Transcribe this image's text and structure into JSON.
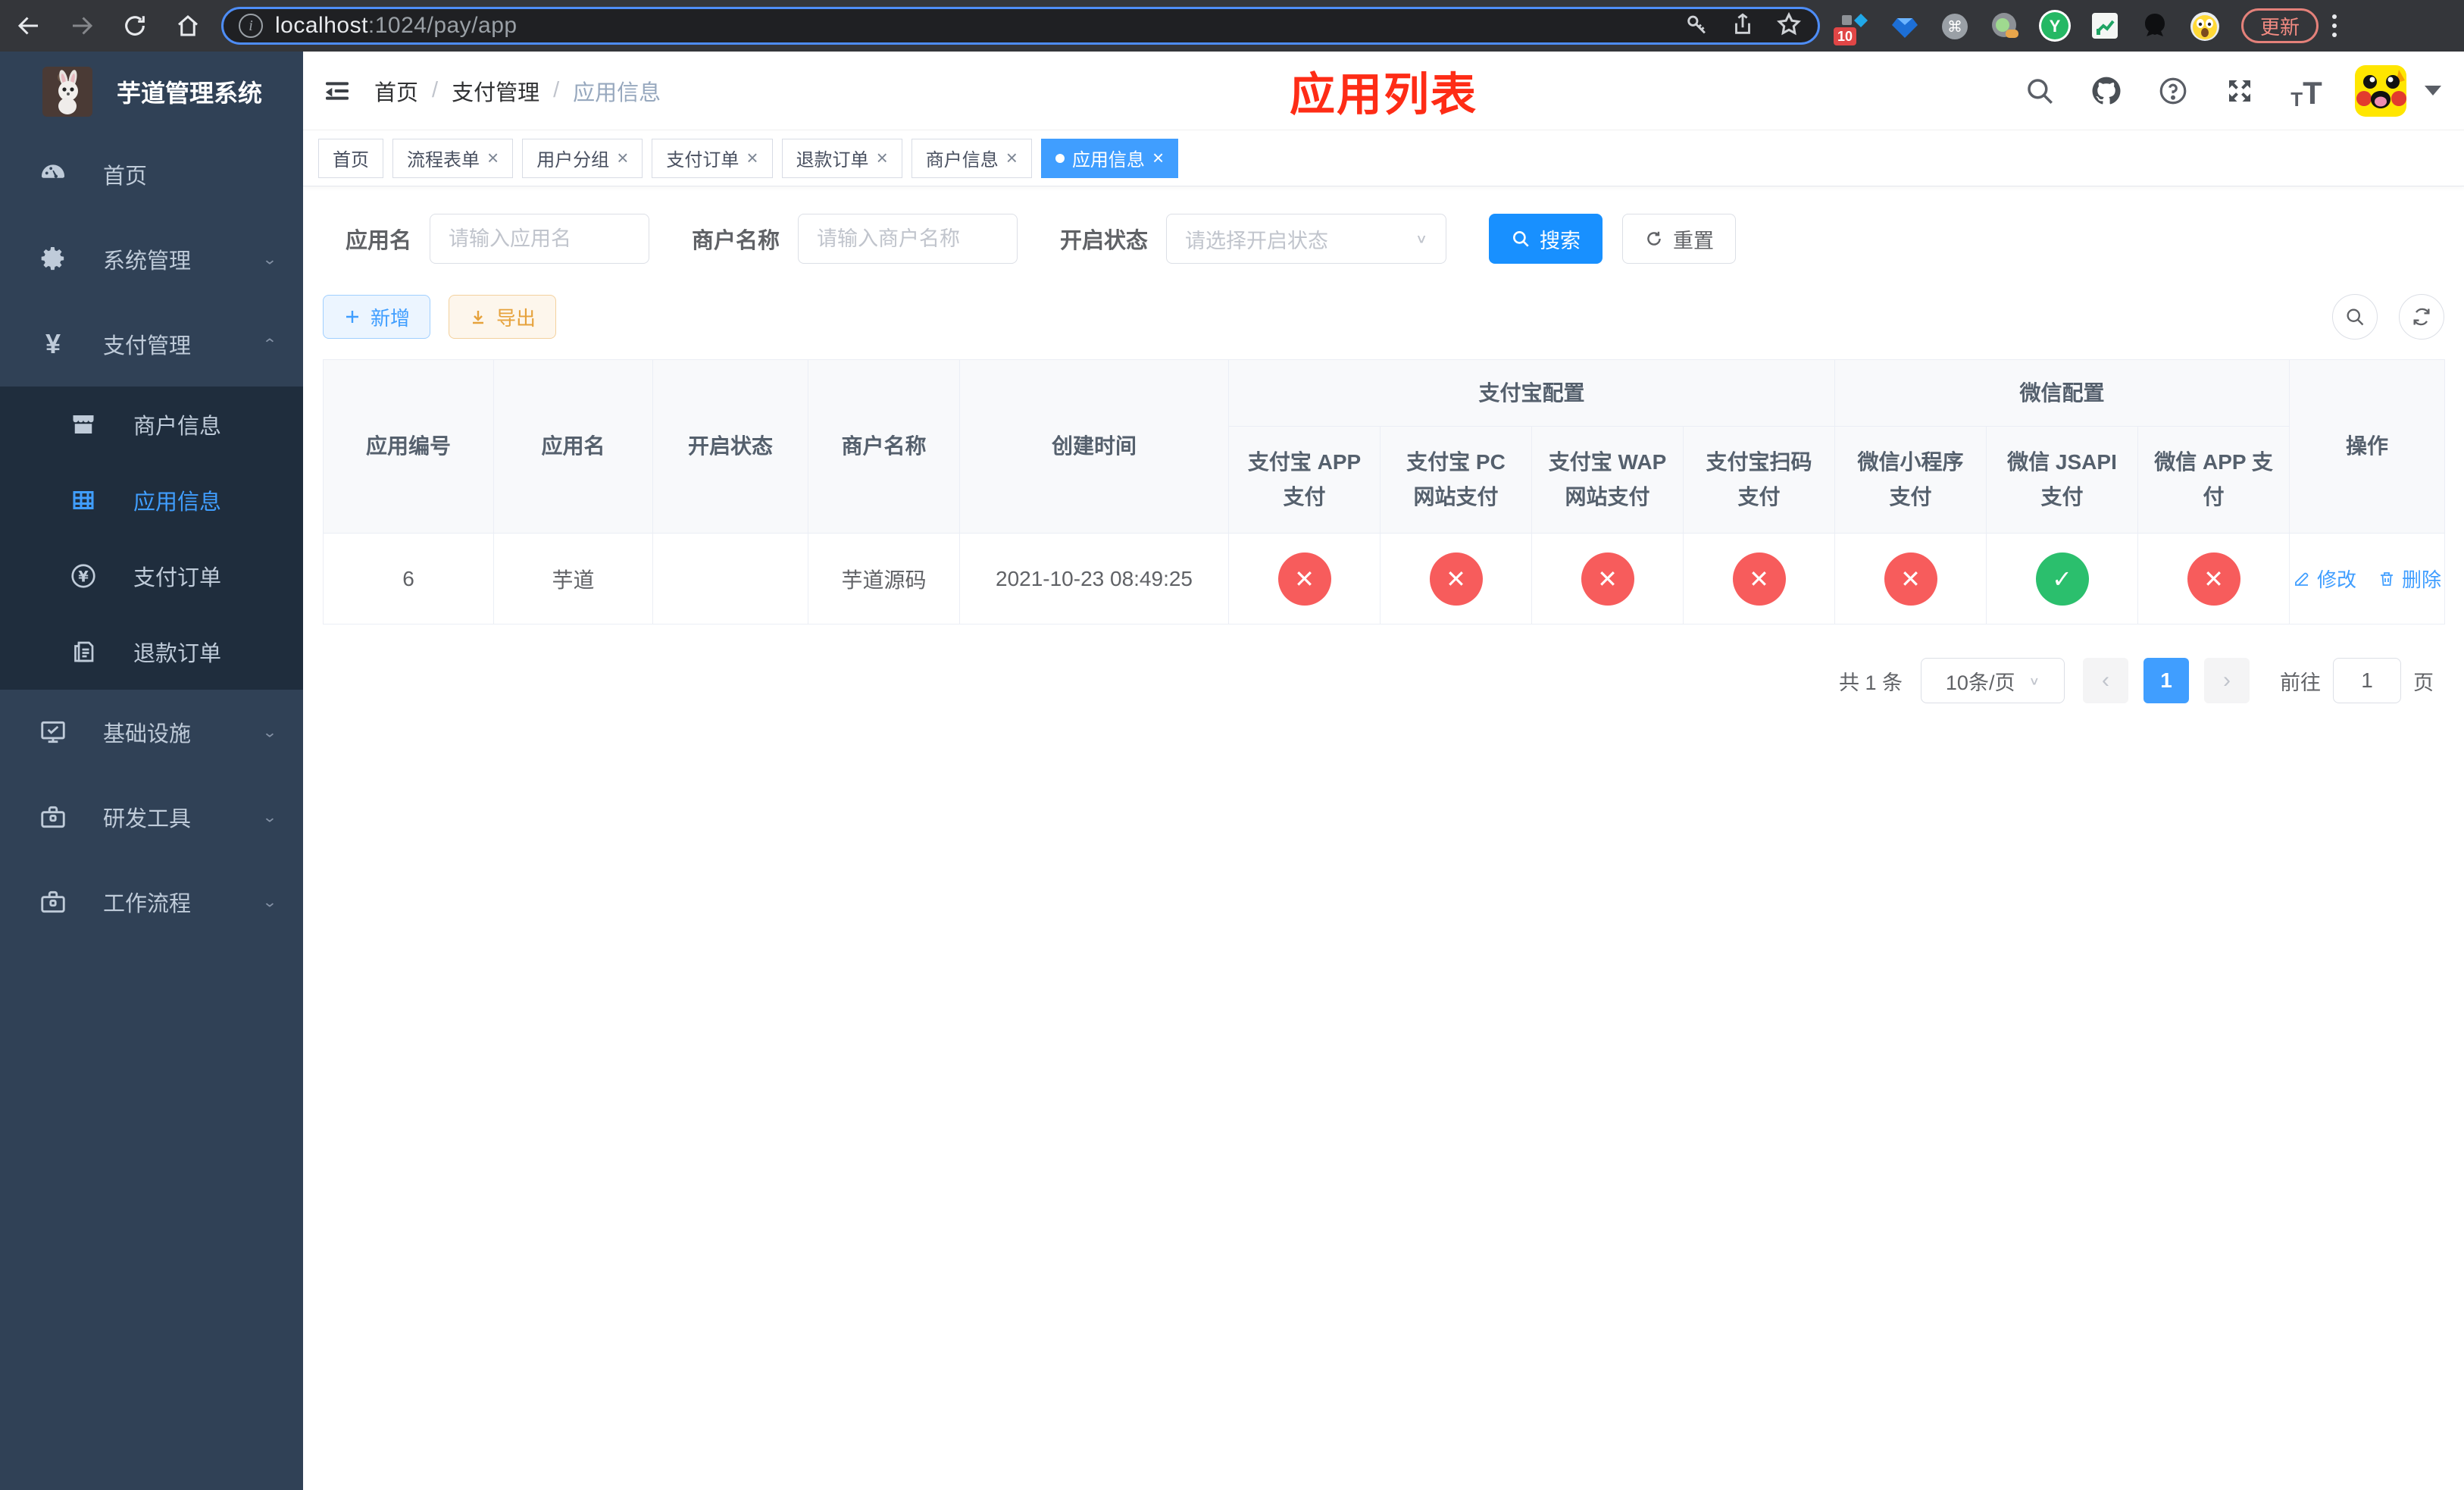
{
  "browser": {
    "url_host": "localhost",
    "url_rest": ":1024/pay/app",
    "extension_badge": "10",
    "update_button": "更新"
  },
  "sidebar": {
    "title": "芋道管理系统",
    "items": [
      {
        "label": "首页"
      },
      {
        "label": "系统管理"
      },
      {
        "label": "支付管理",
        "children": [
          {
            "label": "商户信息"
          },
          {
            "label": "应用信息"
          },
          {
            "label": "支付订单"
          },
          {
            "label": "退款订单"
          }
        ]
      },
      {
        "label": "基础设施"
      },
      {
        "label": "研发工具"
      },
      {
        "label": "工作流程"
      }
    ]
  },
  "header": {
    "breadcrumb": [
      "首页",
      "支付管理",
      "应用信息"
    ],
    "annotation": "应用列表"
  },
  "tabs": [
    {
      "label": "首页"
    },
    {
      "label": "流程表单"
    },
    {
      "label": "用户分组"
    },
    {
      "label": "支付订单"
    },
    {
      "label": "退款订单"
    },
    {
      "label": "商户信息"
    },
    {
      "label": "应用信息"
    }
  ],
  "filters": {
    "app_name_label": "应用名",
    "app_name_placeholder": "请输入应用名",
    "merchant_label": "商户名称",
    "merchant_placeholder": "请输入商户名称",
    "status_label": "开启状态",
    "status_placeholder": "请选择开启状态",
    "search_label": "搜索",
    "reset_label": "重置"
  },
  "toolbar": {
    "add_label": "新增",
    "export_label": "导出"
  },
  "table": {
    "groups": {
      "alipay": "支付宝配置",
      "wechat": "微信配置"
    },
    "columns": [
      "应用编号",
      "应用名",
      "开启状态",
      "商户名称",
      "创建时间",
      "支付宝 APP 支付",
      "支付宝 PC 网站支付",
      "支付宝 WAP 网站支付",
      "支付宝扫码支付",
      "微信小程序支付",
      "微信 JSAPI 支付",
      "微信 APP 支付",
      "操作"
    ],
    "rows": [
      {
        "id": "6",
        "name": "芋道",
        "enabled": true,
        "merchant": "芋道源码",
        "created": "2021-10-23 08:49:25",
        "statuses": [
          "no",
          "no",
          "no",
          "no",
          "no",
          "yes",
          "no"
        ],
        "edit_label": "修改",
        "delete_label": "删除"
      }
    ]
  },
  "pagination": {
    "total": "共 1 条",
    "page_size": "10条/页",
    "current_page": "1",
    "goto_label": "前往",
    "goto_value": "1",
    "page_suffix": "页"
  },
  "glyphs": {
    "close": "×",
    "check": "✓",
    "cross": "✕",
    "caret": "▼",
    "prev": "‹",
    "next": "›"
  },
  "colors": {
    "accent": "#409eff",
    "primary_button": "#1890ff",
    "status_ok": "#2bbf6d",
    "status_no": "#f75c5c",
    "sidebar_bg": "#304156",
    "submenu_bg": "#1f2d3d",
    "annotation_red": "#fe2c16"
  }
}
